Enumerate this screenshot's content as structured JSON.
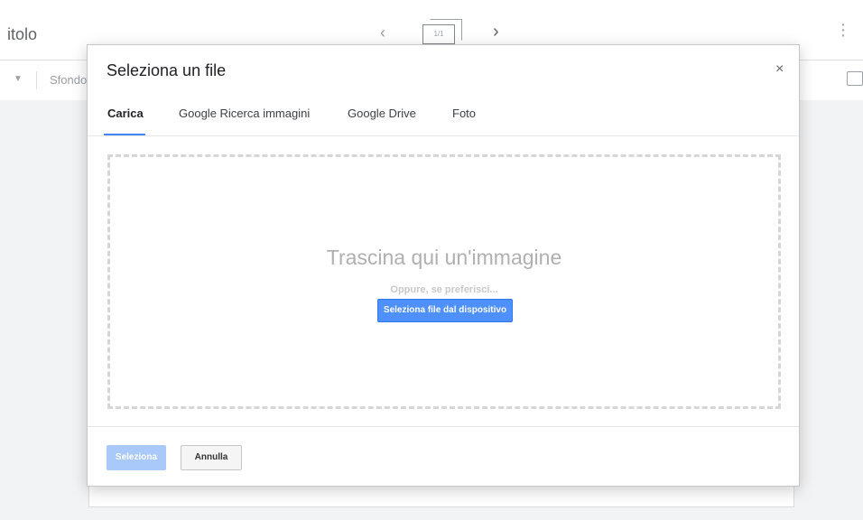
{
  "app": {
    "title_fragment": "itolo",
    "toolbar_background_label": "Sfondo",
    "page_indicator": "1/1"
  },
  "icons": {
    "prev": "chevron-left-icon",
    "next": "chevron-right-icon",
    "more": "more-vert-icon",
    "present": "present-icon",
    "close": "close-icon"
  },
  "dialog": {
    "title": "Seleziona un file",
    "close_glyph": "×",
    "tabs": [
      {
        "label": "Carica",
        "active": true
      },
      {
        "label": "Google Ricerca immagini",
        "active": false
      },
      {
        "label": "Google Drive",
        "active": false
      },
      {
        "label": "Foto",
        "active": false
      }
    ],
    "dropzone": {
      "headline": "Trascina qui un'immagine",
      "or_text": "Oppure, se preferisci...",
      "upload_button": "Seleziona file dal dispositivo"
    },
    "footer": {
      "select_label": "Seleziona",
      "cancel_label": "Annulla"
    }
  },
  "colors": {
    "accent": "#4285f4",
    "upload_button": "#4d90fe",
    "select_disabled": "#a9c9fb"
  }
}
